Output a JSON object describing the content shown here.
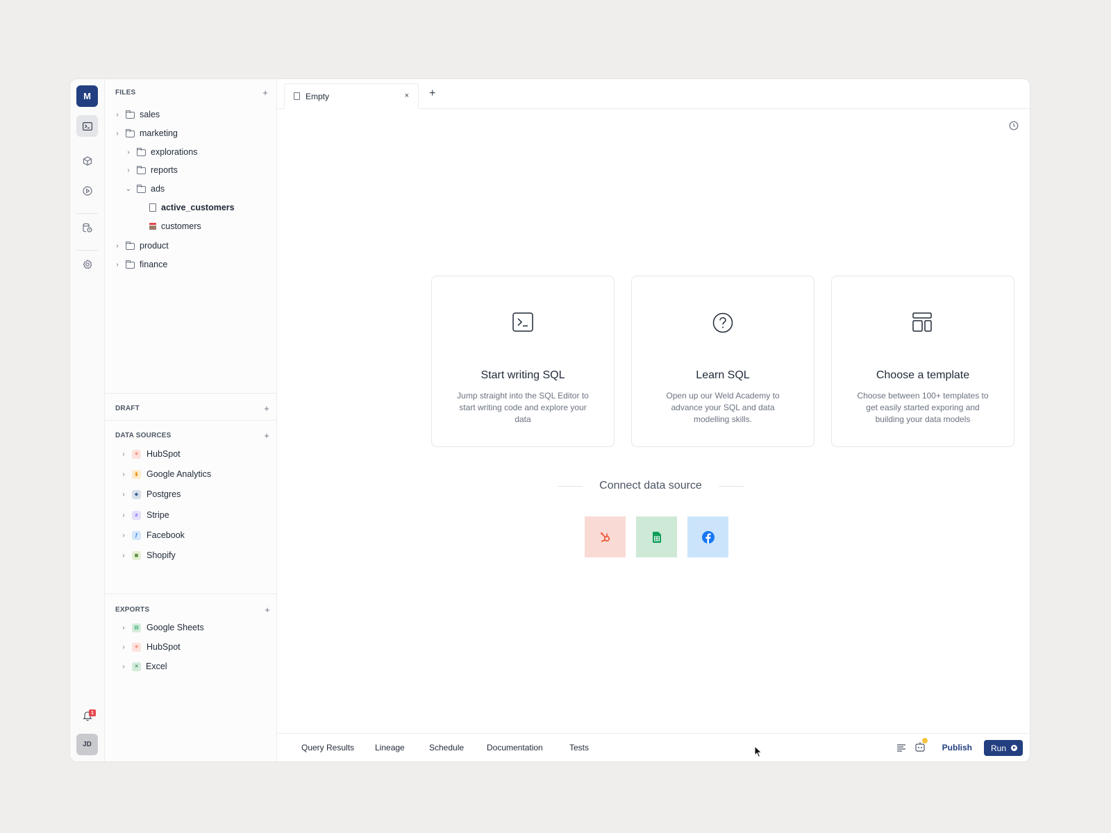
{
  "rail": {
    "workspace_initial": "M",
    "user_initials": "JD",
    "notification_count": "1",
    "accent": "#233f80"
  },
  "files": {
    "header": "FILES",
    "add": "+",
    "items": [
      {
        "label": "sales"
      },
      {
        "label": "marketing"
      },
      {
        "label": "explorations"
      },
      {
        "label": "reports"
      },
      {
        "label": "ads"
      },
      {
        "label": "active_customers"
      },
      {
        "label": "customers"
      },
      {
        "label": "product"
      },
      {
        "label": "finance"
      }
    ]
  },
  "draft": {
    "header": "DRAFT",
    "add": "+"
  },
  "data_sources": {
    "header": "DATA SOURCES",
    "add": "+",
    "items": [
      {
        "label": "HubSpot",
        "icon": "hubspot-icon"
      },
      {
        "label": "Google Analytics",
        "icon": "google-analytics-icon"
      },
      {
        "label": "Postgres",
        "icon": "postgres-icon"
      },
      {
        "label": "Stripe",
        "icon": "stripe-icon"
      },
      {
        "label": "Facebook",
        "icon": "facebook-icon"
      },
      {
        "label": "Shopify",
        "icon": "shopify-icon"
      }
    ]
  },
  "exports": {
    "header": "EXPORTS",
    "add": "+",
    "items": [
      {
        "label": "Google Sheets",
        "icon": "google-sheets-icon"
      },
      {
        "label": "HubSpot",
        "icon": "hubspot-icon"
      },
      {
        "label": "Excel",
        "icon": "excel-icon"
      }
    ]
  },
  "tabs": {
    "active_label": "Empty",
    "close": "×",
    "add": "+"
  },
  "cards": [
    {
      "title": "Start writing SQL",
      "description": "Jump straight into the SQL Editor to start writing code and explore your data"
    },
    {
      "title": "Learn SQL",
      "description": "Open up our Weld Academy to advance your SQL and data modelling skills."
    },
    {
      "title": "Choose a template",
      "description": "Choose between 100+ templates to get easily started exporing and building your data models"
    }
  ],
  "connect": {
    "title": "Connect data source"
  },
  "bottom": {
    "tabs": [
      "Query Results",
      "Lineage",
      "Schedule",
      "Documentation",
      "Tests"
    ],
    "publish": "Publish",
    "run": "Run"
  }
}
